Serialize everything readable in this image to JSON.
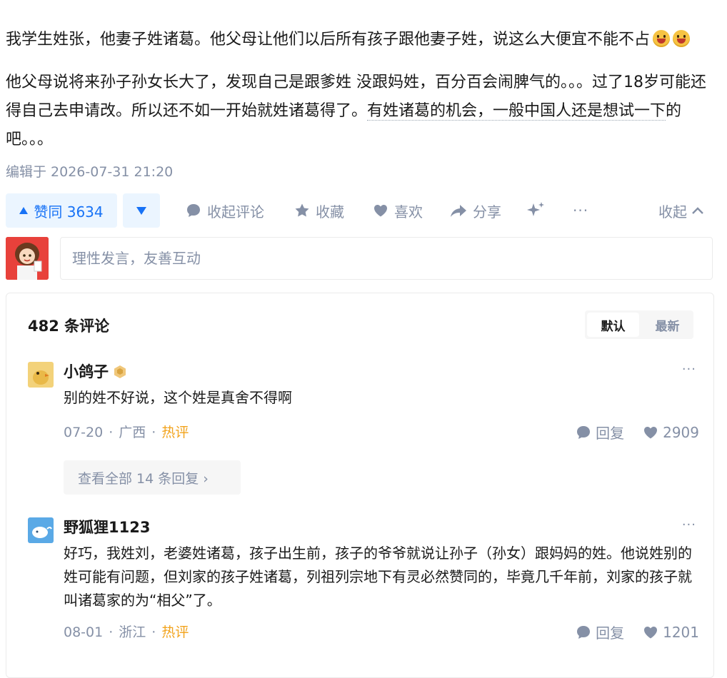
{
  "post": {
    "para1": "我学生姓张，他妻子姓诸葛。他父母让他们以后所有孩子跟他妻子姓，说这么大便宜不能不占",
    "para2_a": "他父母说将来孙子孙女长大了，发现自己是跟爹姓 没跟妈姓，百分百会闹脾气的。。。过了18岁可能还得自己去申请改。所以还不如一开始就姓诸葛得了。",
    "para2_b": "有姓诸葛的机会，一般中国人还是想试一下",
    "para2_c": "的吧。。。",
    "edited": "编辑于 2026-07-31 21:20"
  },
  "actions": {
    "upvote": "赞同 3634",
    "collapse_comments": "收起评论",
    "favorite": "收藏",
    "like": "喜欢",
    "share": "分享",
    "more": "···",
    "collapse": "收起"
  },
  "composer": {
    "placeholder": "理性发言，友善互动"
  },
  "comments": {
    "count": "482 条评论",
    "sort_default": "默认",
    "sort_latest": "最新",
    "items": [
      {
        "user": "小鸽子",
        "text": "别的姓不好说，这个姓是真舍不得啊",
        "date": "07-20",
        "region": "广西",
        "hot": "热评",
        "reply": "回复",
        "likes": "2909",
        "view_replies": "查看全部 14 条回复 ›"
      },
      {
        "user": "野狐狸1123",
        "text": "好巧，我姓刘，老婆姓诸葛，孩子出生前，孩子的爷爷就说让孙子（孙女）跟妈妈的姓。他说姓别的姓可能有问题，但刘家的孩子姓诸葛，列祖列宗地下有灵必然赞同的，毕竟几千年前，刘家的孩子就叫诸葛家的为“相父”了。",
        "date": "08-01",
        "region": "浙江",
        "hot": "热评",
        "reply": "回复",
        "likes": "1201"
      }
    ],
    "more_label": "···"
  }
}
